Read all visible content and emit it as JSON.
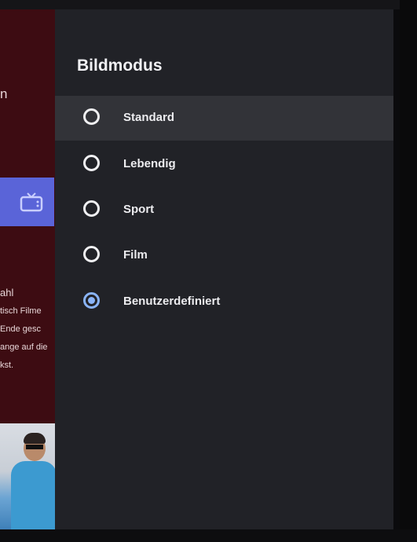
{
  "background_app": {
    "title_fragment": "n",
    "section_fragment": "ahl",
    "text_lines": [
      "tisch Filme",
      "Ende gesc",
      "ange auf die",
      "kst."
    ]
  },
  "panel": {
    "title": "Bildmodus",
    "options": [
      {
        "label": "Standard",
        "selected": false,
        "focused": true
      },
      {
        "label": "Lebendig",
        "selected": false,
        "focused": false
      },
      {
        "label": "Sport",
        "selected": false,
        "focused": false
      },
      {
        "label": "Film",
        "selected": false,
        "focused": false
      },
      {
        "label": "Benutzerdefiniert",
        "selected": true,
        "focused": false
      }
    ]
  },
  "colors": {
    "panel_bg": "#212227",
    "focus_bg": "#323338",
    "accent": "#8ab4f8",
    "background_app": "#3d0c12",
    "tv_tile": "#5a64d8"
  }
}
